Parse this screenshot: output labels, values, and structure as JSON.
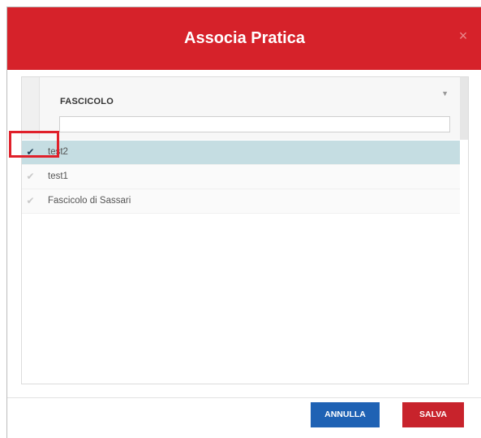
{
  "dialog": {
    "title": "Associa Pratica",
    "close_icon": "×"
  },
  "grid": {
    "column_header": "FASCICOLO",
    "filter_value": "",
    "sort_icon": "▼",
    "rows": [
      {
        "label": "test2",
        "checked": true,
        "check_glyph": "✔"
      },
      {
        "label": "test1",
        "checked": false,
        "check_glyph": "✔"
      },
      {
        "label": "Fascicolo di Sassari",
        "checked": false,
        "check_glyph": "✔"
      }
    ]
  },
  "buttons": {
    "cancel": "ANNULLA",
    "save": "SALVA"
  },
  "colors": {
    "header_red": "#d6222a",
    "cancel_blue": "#1f62b4",
    "save_red": "#c8232c",
    "selected_row": "#c5dde2"
  }
}
